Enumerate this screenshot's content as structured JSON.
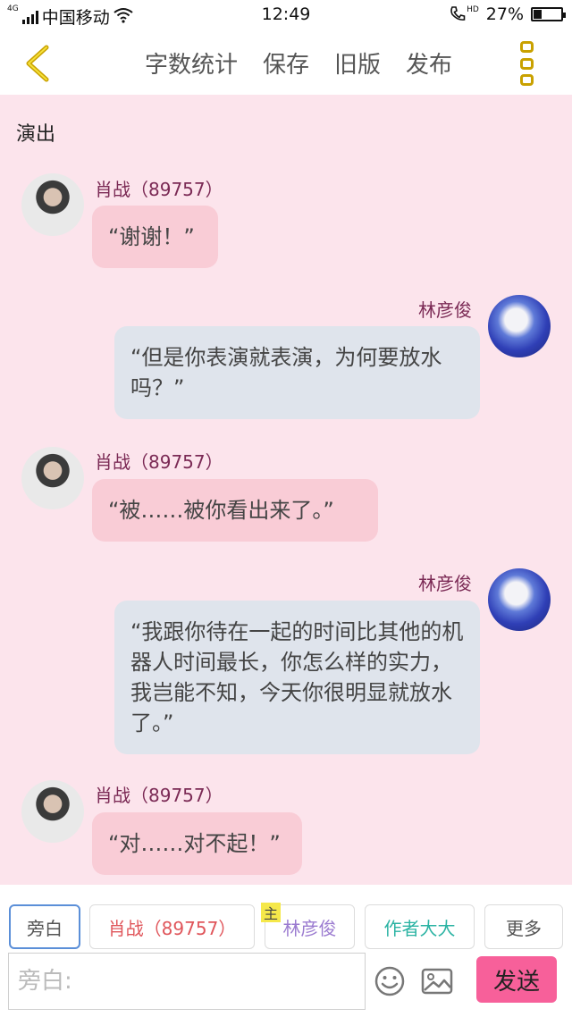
{
  "status_bar": {
    "network": "4G",
    "carrier": "中国移动",
    "time": "12:49",
    "hd_label": "HD",
    "battery": "27%",
    "battery_level": 0.27
  },
  "header": {
    "back_icon": "chevron-left-icon",
    "actions": [
      "字数统计",
      "保存",
      "旧版",
      "发布"
    ],
    "more_icon": "more-vertical-icon",
    "accent_color": "#c9a100"
  },
  "scene": {
    "title": "演出"
  },
  "messages": [
    {
      "side": "left",
      "speaker": "肖战（89757）",
      "text": "“谢谢！”"
    },
    {
      "side": "right",
      "speaker": "林彦俊",
      "text": "“但是你表演就表演，为何要放水吗？”"
    },
    {
      "side": "left",
      "speaker": "肖战（89757）",
      "text": "“被……被你看出来了。”"
    },
    {
      "side": "right",
      "speaker": "林彦俊",
      "text": "“我跟你待在一起的时间比其他的机器人时间最长，你怎么样的实力，我岂能不知，今天你很明显就放水了。”"
    },
    {
      "side": "left",
      "speaker": "肖战（89757）",
      "text": "“对……对不起！”"
    }
  ],
  "roles": [
    {
      "label": "旁白",
      "color": "#555555",
      "selected": true
    },
    {
      "label": "肖战（89757）",
      "color": "#e0565b",
      "selected": false
    },
    {
      "label": "林彦俊",
      "color": "#9b7bd0",
      "selected": false,
      "badge": "主"
    },
    {
      "label": "作者大大",
      "color": "#2bb3a3",
      "selected": false
    },
    {
      "label": "更多",
      "color": "#555555",
      "selected": false
    }
  ],
  "composer": {
    "placeholder": "旁白:",
    "emoji_icon": "smiley-icon",
    "image_icon": "image-icon",
    "send_label": "发送",
    "send_color": "#f7609a"
  },
  "colors": {
    "background": "#fce4ec",
    "left_bubble": "#f9ccd6",
    "right_bubble": "#dfe4ec",
    "speaker_name": "#7b2a55"
  }
}
